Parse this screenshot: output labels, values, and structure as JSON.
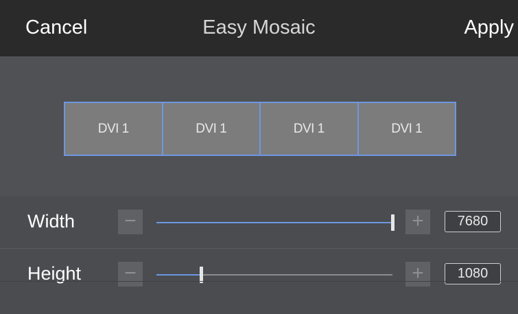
{
  "header": {
    "cancel_label": "Cancel",
    "title": "Easy Mosaic",
    "apply_label": "Apply"
  },
  "mosaic": {
    "tiles": [
      {
        "label": "DVI 1"
      },
      {
        "label": "DVI 1"
      },
      {
        "label": "DVI 1"
      },
      {
        "label": "DVI 1"
      }
    ]
  },
  "controls": {
    "width": {
      "label": "Width",
      "minus_icon": "−",
      "plus_icon": "+",
      "value": "7680",
      "slider_fraction": 1.0
    },
    "height": {
      "label": "Height",
      "minus_icon": "−",
      "plus_icon": "+",
      "value": "1080",
      "slider_fraction": 0.19
    }
  },
  "colors": {
    "accent": "#6e97e0",
    "header_bg": "#2a2a2a",
    "tile_bg": "#7c7c7c"
  }
}
